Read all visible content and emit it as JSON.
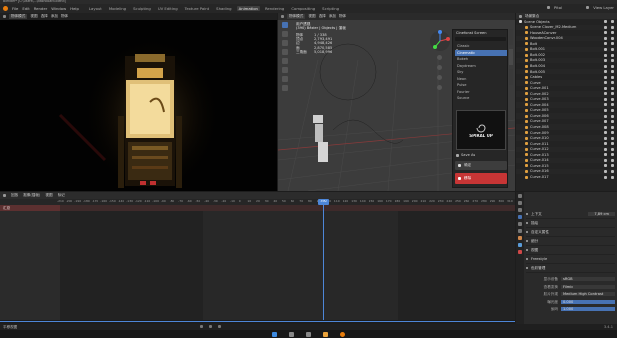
{
  "window": {
    "title": "Blender* [C:\\Users\\...\\dashboard.blend]"
  },
  "menu": [
    "File",
    "Edit",
    "Render",
    "Window",
    "Help"
  ],
  "workspaces": [
    {
      "label": "Layout",
      "active": false
    },
    {
      "label": "Modeling",
      "active": false
    },
    {
      "label": "Sculpting",
      "active": false
    },
    {
      "label": "UV Editing",
      "active": false
    },
    {
      "label": "Texture Paint",
      "active": false
    },
    {
      "label": "Shading",
      "active": false
    },
    {
      "label": "Animation",
      "active": true
    },
    {
      "label": "Rendering",
      "active": false
    },
    {
      "label": "Compositing",
      "active": false
    },
    {
      "label": "Scripting",
      "active": false
    }
  ],
  "topright": {
    "scene": "Pitol",
    "view_layer": "View Layer"
  },
  "viewport_left": {
    "mode": "物体模式",
    "view": "视图",
    "select": "选择",
    "add": "添加",
    "object": "物体"
  },
  "viewport_right": {
    "mode": "物体模式",
    "view": "视图",
    "select": "选择",
    "add": "添加",
    "object": "物体",
    "stats_title": "用户透视",
    "stats_subtitle": "(390) Bézier | Objects | 渲帧",
    "stats": [
      {
        "k": "物体",
        "v": "1 / 338"
      },
      {
        "k": "顶点",
        "v": "2,793,491"
      },
      {
        "k": "边",
        "v": "4,948,426"
      },
      {
        "k": "面",
        "v": "2,870,585"
      },
      {
        "k": "三角面",
        "v": "5,018,996"
      }
    ]
  },
  "npanel": {
    "header": "Cinefonst Screen",
    "items": [
      {
        "label": "Classic",
        "active": false
      },
      {
        "label": "Cinematic",
        "active": true
      },
      {
        "label": "Bokeh",
        "active": false
      },
      {
        "label": "Daydream",
        "active": false
      },
      {
        "label": "Sky",
        "active": false
      },
      {
        "label": "Neon",
        "active": false
      },
      {
        "label": "Pulse",
        "active": false
      },
      {
        "label": "Fourier",
        "active": false
      },
      {
        "label": "Source",
        "active": false
      }
    ],
    "preview_text": "SPIRAL UP",
    "save_label": "Save As",
    "apply_label": "确定",
    "remove_label": "移除",
    "accent": "#c73535"
  },
  "outliner": {
    "header": "场景集合",
    "rows": [
      {
        "label": "Scene Objects",
        "color": "#d8d8d8",
        "indent": 0
      },
      {
        "label": "Scene Clover_M2.Medium",
        "color": "#e0a040",
        "indent": 1
      },
      {
        "label": "HouseAConver",
        "color": "#e0a040",
        "indent": 1
      },
      {
        "label": "WoodenConvr.004",
        "color": "#e0a040",
        "indent": 1
      },
      {
        "label": "Bolt",
        "color": "#e0a040",
        "indent": 1
      },
      {
        "label": "Bolt.001",
        "color": "#e0a040",
        "indent": 1
      },
      {
        "label": "Bolt.002",
        "color": "#e0a040",
        "indent": 1
      },
      {
        "label": "Bolt.003",
        "color": "#e0a040",
        "indent": 1
      },
      {
        "label": "Bolt.004",
        "color": "#e0a040",
        "indent": 1
      },
      {
        "label": "Bolt.005",
        "color": "#e0a040",
        "indent": 1
      },
      {
        "label": "Cables",
        "color": "#e0a040",
        "indent": 1
      },
      {
        "label": "Curve",
        "color": "#e0a040",
        "indent": 1
      },
      {
        "label": "Curve.001",
        "color": "#e0a040",
        "indent": 1
      },
      {
        "label": "Curve.002",
        "color": "#e0a040",
        "indent": 1
      },
      {
        "label": "Curve.003",
        "color": "#e0a040",
        "indent": 1
      },
      {
        "label": "Curve.004",
        "color": "#e0a040",
        "indent": 1
      },
      {
        "label": "Curve.005",
        "color": "#e0a040",
        "indent": 1
      },
      {
        "label": "Curve.006",
        "color": "#e0a040",
        "indent": 1
      },
      {
        "label": "Curve.007",
        "color": "#e0a040",
        "indent": 1
      },
      {
        "label": "Curve.008",
        "color": "#e0a040",
        "indent": 1
      },
      {
        "label": "Curve.009",
        "color": "#e0a040",
        "indent": 1
      },
      {
        "label": "Curve.010",
        "color": "#e0a040",
        "indent": 1
      },
      {
        "label": "Curve.011",
        "color": "#e0a040",
        "indent": 1
      },
      {
        "label": "Curve.012",
        "color": "#e0a040",
        "indent": 1
      },
      {
        "label": "Curve.013",
        "color": "#e0a040",
        "indent": 1
      },
      {
        "label": "Curve.014",
        "color": "#e0a040",
        "indent": 1
      },
      {
        "label": "Curve.015",
        "color": "#e0a040",
        "indent": 1
      },
      {
        "label": "Curve.016",
        "color": "#e0a040",
        "indent": 1
      },
      {
        "label": "Curve.017",
        "color": "#e0a040",
        "indent": 1
      }
    ]
  },
  "properties": {
    "sections": [
      {
        "label": "上下文",
        "value": "7,89 cm"
      },
      {
        "label": "描绘",
        "value": ""
      },
      {
        "label": "自定义属性",
        "value": ""
      },
      {
        "label": "细分",
        "value": ""
      },
      {
        "label": "视图",
        "value": ""
      },
      {
        "label": "Freestyle",
        "value": ""
      },
      {
        "label": "色彩管理",
        "value": ""
      }
    ],
    "fields": [
      {
        "label": "显示设备",
        "value": "sRGB"
      },
      {
        "label": "查看变换",
        "value": "Filmic"
      },
      {
        "label": "胶片外观",
        "value": "Medium High Contrast"
      },
      {
        "label": "曝光度",
        "value": "0.000"
      },
      {
        "label": "伽玛",
        "value": "1.000"
      }
    ]
  },
  "timeline": {
    "menu": [
      "回放",
      "抠像(插帧)",
      "视图",
      "标记"
    ],
    "ticks": [
      "-210",
      "-200",
      "-190",
      "-180",
      "-170",
      "-160",
      "-150",
      "-140",
      "-130",
      "-120",
      "-110",
      "-100",
      "-90",
      "-80",
      "-70",
      "-60",
      "-50",
      "-40",
      "-30",
      "-20",
      "-10",
      "0",
      "10",
      "20",
      "30",
      "40",
      "50",
      "60",
      "70",
      "80",
      "90",
      "100",
      "110",
      "120",
      "130",
      "140",
      "150",
      "160",
      "170",
      "180",
      "190",
      "200",
      "210",
      "220",
      "230",
      "240",
      "250",
      "260",
      "270",
      "280",
      "290",
      "300",
      "310"
    ],
    "current_frame": "390",
    "track_label": "汇总",
    "frame_start": "1",
    "frame_end": "280"
  },
  "status": {
    "left": "平移视图",
    "right": "3.4.1"
  }
}
